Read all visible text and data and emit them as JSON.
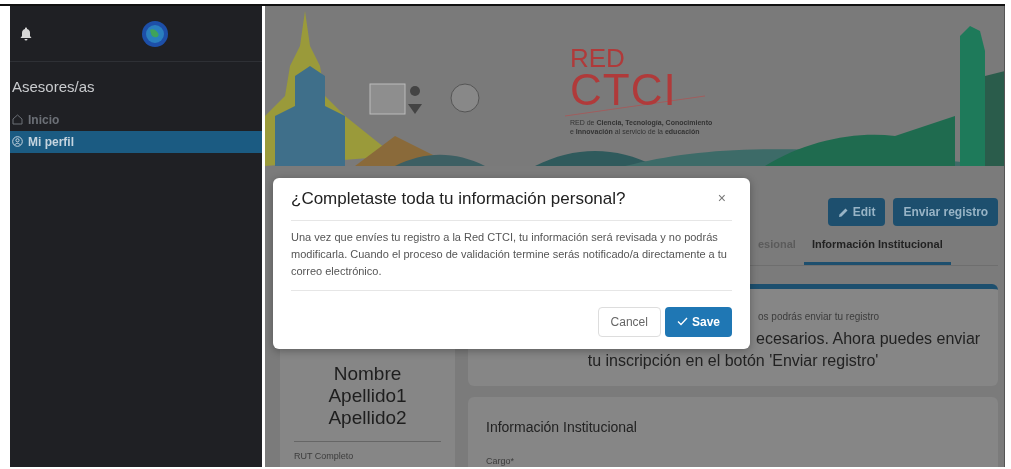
{
  "sidebar": {
    "title": "Asesores/as",
    "items": [
      {
        "label": "Inicio",
        "selected": false
      },
      {
        "label": "Mi perfil",
        "selected": true
      }
    ]
  },
  "banner": {
    "logo_top": "RED",
    "logo_main": "CTCI",
    "tagline_lines": [
      "RED de **Ciencia, Tecnología, Conocimiento**",
      "e **Innovación** al servicio de la **educación**"
    ]
  },
  "actions": [
    {
      "label": "Edit",
      "kind": "edit"
    },
    {
      "label": "Enviar registro",
      "kind": "submit"
    }
  ],
  "tabs": [
    {
      "label": "esional",
      "selected": false
    },
    {
      "label": "Información Institucional",
      "selected": true
    }
  ],
  "alert": {
    "caption": "os podrás enviar tu registro",
    "message_lines": [
      "ecesarios. Ahora puedes enviar",
      "tu inscripción en el botón 'Enviar registro'"
    ]
  },
  "profile": {
    "name_lines": [
      "Nombre",
      "Apellido1",
      "Apellido2"
    ],
    "fields": [
      "RUT Completo"
    ]
  },
  "section": {
    "title": "Información Institucional",
    "fields": [
      "Cargo*"
    ]
  },
  "dialog": {
    "title": "¿Completaste toda tu información personal?",
    "close": "×",
    "body": "Una vez que envíes tu registro a la Red CTCI, tu información será revisada y no podrás modificarla. Cuando el proceso de validación termine serás notificado/a directamente a tu correo electrónico.",
    "buttons": [
      {
        "label": "Cancel",
        "kind": "secondary"
      },
      {
        "label": "Save",
        "kind": "primary"
      }
    ]
  }
}
